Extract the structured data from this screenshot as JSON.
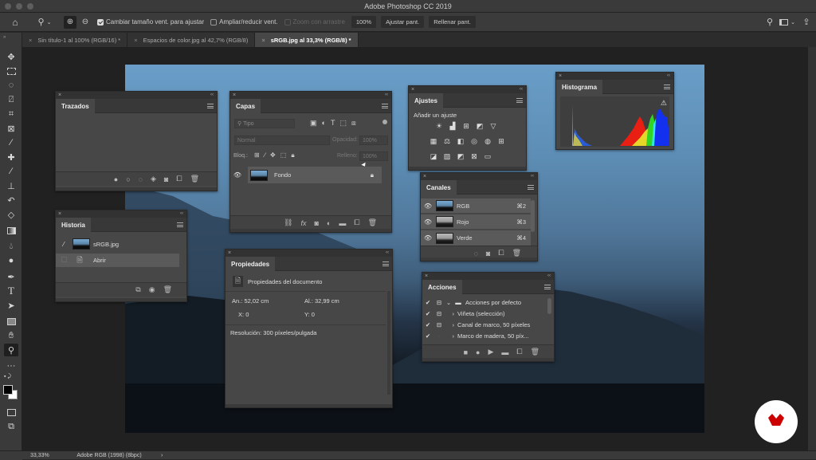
{
  "app": {
    "title": "Adobe Photoshop CC 2019"
  },
  "options_bar": {
    "home_icon": "home-icon",
    "zoom_tool_icon": "zoom-tool-icon",
    "zoom_in_icon": "zoom-in-icon",
    "zoom_out_icon": "zoom-out-icon",
    "resize_windows_label": "Cambiar tamaño vent. para ajustar",
    "resize_windows_checked": true,
    "zoom_all_windows_label": "Ampliar/reducir vent.",
    "zoom_all_windows_checked": false,
    "scrubby_zoom_label": "Zoom con arrastre",
    "zoom_value": "100%",
    "fit_screen_label": "Ajustar pant.",
    "fill_screen_label": "Rellenar pant."
  },
  "tabs": [
    {
      "label": "Sin título-1 al 100% (RGB/16) *",
      "active": false
    },
    {
      "label": "Espacios de color.jpg al 42,7% (RGB/8)",
      "active": false
    },
    {
      "label": "sRGB.jpg al 33,3% (RGB/8) *",
      "active": true
    }
  ],
  "tools": [
    "move",
    "marquee",
    "lasso",
    "quick-select",
    "crop",
    "frame",
    "eyedropper",
    "healing",
    "brush",
    "stamp",
    "history-brush",
    "eraser",
    "gradient",
    "blur",
    "dodge",
    "pen",
    "type",
    "path-select",
    "rectangle",
    "hand",
    "zoom",
    "more",
    "swap-colors",
    "foreground-background",
    "quick-mask",
    "screen-mode"
  ],
  "panels": {
    "trazados": {
      "title": "Trazados"
    },
    "historia": {
      "title": "Historia",
      "items": [
        {
          "label": "sRGB.jpg",
          "type": "snapshot"
        },
        {
          "label": "Abrir",
          "type": "state"
        }
      ]
    },
    "capas": {
      "title": "Capas",
      "filter_placeholder": "Tipo",
      "blend_mode": "Normal",
      "opacity_label": "Opacidad:",
      "opacity_value": "100%",
      "lock_label": "Bloq.:",
      "fill_label": "Relleno:",
      "fill_value": "100%",
      "layers": [
        {
          "name": "Fondo",
          "visible": true,
          "locked": true
        }
      ]
    },
    "propiedades": {
      "title": "Propiedades",
      "subtitle": "Propiedades del documento",
      "width_label": "An.:",
      "width_value": "52,02 cm",
      "height_label": "Al.:",
      "height_value": "32,99 cm",
      "x_label": "X:",
      "x_value": "0",
      "y_label": "Y:",
      "y_value": "0",
      "resolution": "Resolución: 300 píxeles/pulgada"
    },
    "ajustes": {
      "title": "Ajustes",
      "subtitle": "Añadir un ajuste"
    },
    "canales": {
      "title": "Canales",
      "channels": [
        {
          "name": "RGB",
          "shortcut": "⌘2"
        },
        {
          "name": "Rojo",
          "shortcut": "⌘3"
        },
        {
          "name": "Verde",
          "shortcut": "⌘4"
        }
      ]
    },
    "acciones": {
      "title": "Acciones",
      "items": [
        {
          "label": "Acciones por defecto",
          "kind": "set"
        },
        {
          "label": "Viñeta (selección)",
          "kind": "action"
        },
        {
          "label": "Canal de marco, 50 píxeles",
          "kind": "action"
        },
        {
          "label": "Marco de madera, 50 píx...",
          "kind": "action"
        }
      ]
    },
    "histograma": {
      "title": "Histograma",
      "warning_icon": "warning-icon"
    }
  },
  "status_bar": {
    "zoom": "33,33%",
    "profile": "Adobe RGB (1998) (8bpc)",
    "arrow": "›"
  },
  "colors": {
    "panel_bg": "#474747",
    "canvas_bg": "#212121",
    "logo_red": "#cc0000"
  }
}
